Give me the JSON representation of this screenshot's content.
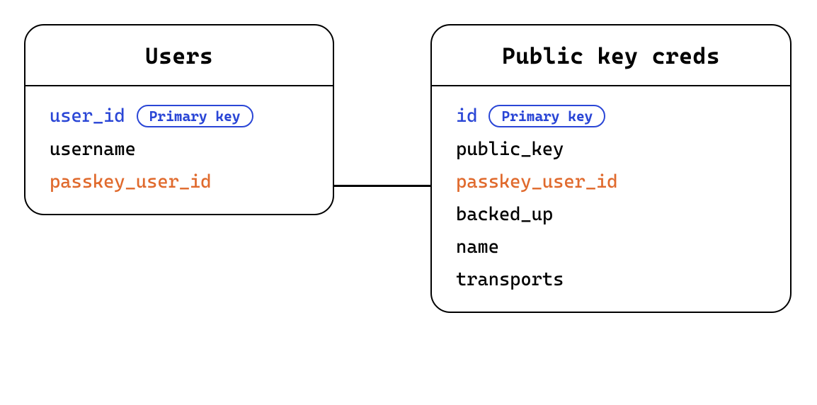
{
  "entities": {
    "users": {
      "title": "Users",
      "fields": [
        {
          "name": "user_id",
          "pk": true,
          "fk": false,
          "badge": "Primary key"
        },
        {
          "name": "username",
          "pk": false,
          "fk": false,
          "badge": null
        },
        {
          "name": "passkey_user_id",
          "pk": false,
          "fk": true,
          "badge": null
        }
      ]
    },
    "creds": {
      "title": "Public key creds",
      "fields": [
        {
          "name": "id",
          "pk": true,
          "fk": false,
          "badge": "Primary key"
        },
        {
          "name": "public_key",
          "pk": false,
          "fk": false,
          "badge": null
        },
        {
          "name": "passkey_user_id",
          "pk": false,
          "fk": true,
          "badge": null
        },
        {
          "name": "backed_up",
          "pk": false,
          "fk": false,
          "badge": null
        },
        {
          "name": "name",
          "pk": false,
          "fk": false,
          "badge": null
        },
        {
          "name": "transports",
          "pk": false,
          "fk": false,
          "badge": null
        }
      ]
    }
  },
  "relation": {
    "from": "users.passkey_user_id",
    "to": "creds.passkey_user_id"
  },
  "colors": {
    "border": "#000000",
    "pk": "#2a46d6",
    "fk": "#e06a2d"
  }
}
